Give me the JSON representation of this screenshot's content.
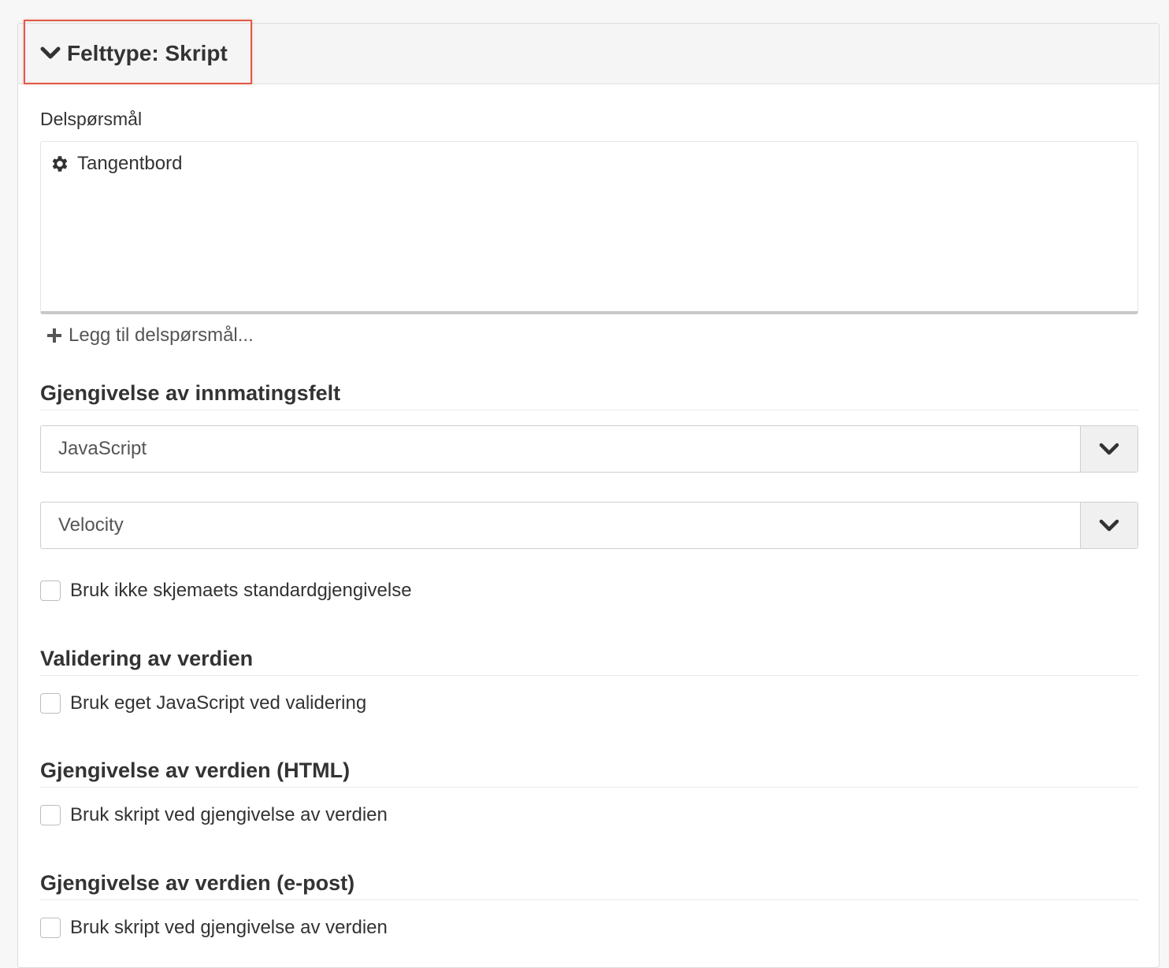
{
  "header": {
    "title": "Felttype: Skript"
  },
  "subquestions": {
    "label": "Delspørsmål",
    "items": [
      {
        "label": "Tangentbord"
      }
    ],
    "add_label": "Legg til delspørsmål..."
  },
  "sections": {
    "input_rendering": {
      "title": "Gjengivelse av innmatingsfelt",
      "select1_value": "JavaScript",
      "select2_value": "Velocity",
      "checkbox_label": "Bruk ikke skjemaets standardgjengivelse"
    },
    "validation": {
      "title": "Validering av verdien",
      "checkbox_label": "Bruk eget JavaScript ved validering"
    },
    "html_rendering": {
      "title": "Gjengivelse av verdien (HTML)",
      "checkbox_label": "Bruk skript ved gjengivelse av verdien"
    },
    "email_rendering": {
      "title": "Gjengivelse av verdien (e-post)",
      "checkbox_label": "Bruk skript ved gjengivelse av verdien"
    }
  },
  "colors": {
    "highlight": "#e05a47",
    "text": "#333333"
  }
}
